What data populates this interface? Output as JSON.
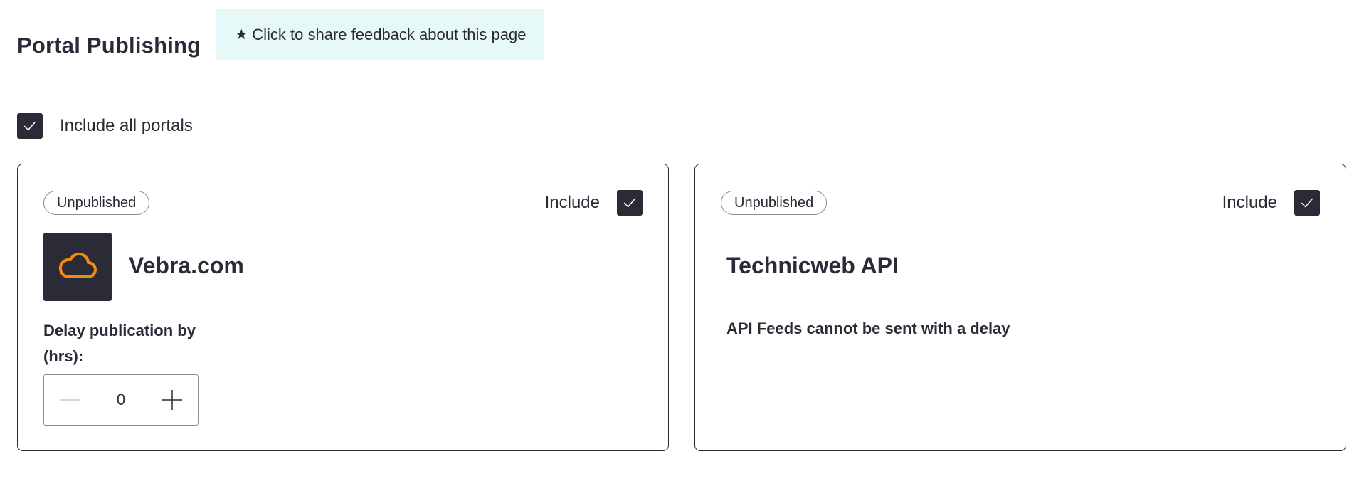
{
  "header": {
    "title": "Portal Publishing",
    "feedback_star": "★",
    "feedback_label": "Click to share feedback about this page"
  },
  "include_all": {
    "label": "Include all portals",
    "checked": true
  },
  "portals": [
    {
      "status": "Unpublished",
      "include_label": "Include",
      "included": true,
      "name": "Vebra.com",
      "logo_icon": "cloud-icon",
      "logo_color": "#f28c0f",
      "delay_label": "Delay publication by (hrs):",
      "delay_value": "0"
    },
    {
      "status": "Unpublished",
      "include_label": "Include",
      "included": true,
      "name": "Technicweb API",
      "note": "API Feeds cannot be sent with a delay"
    }
  ],
  "colors": {
    "primary_dark": "#2a2b36",
    "feedback_bg": "#e6f8f7",
    "accent_orange": "#f28c0f"
  }
}
